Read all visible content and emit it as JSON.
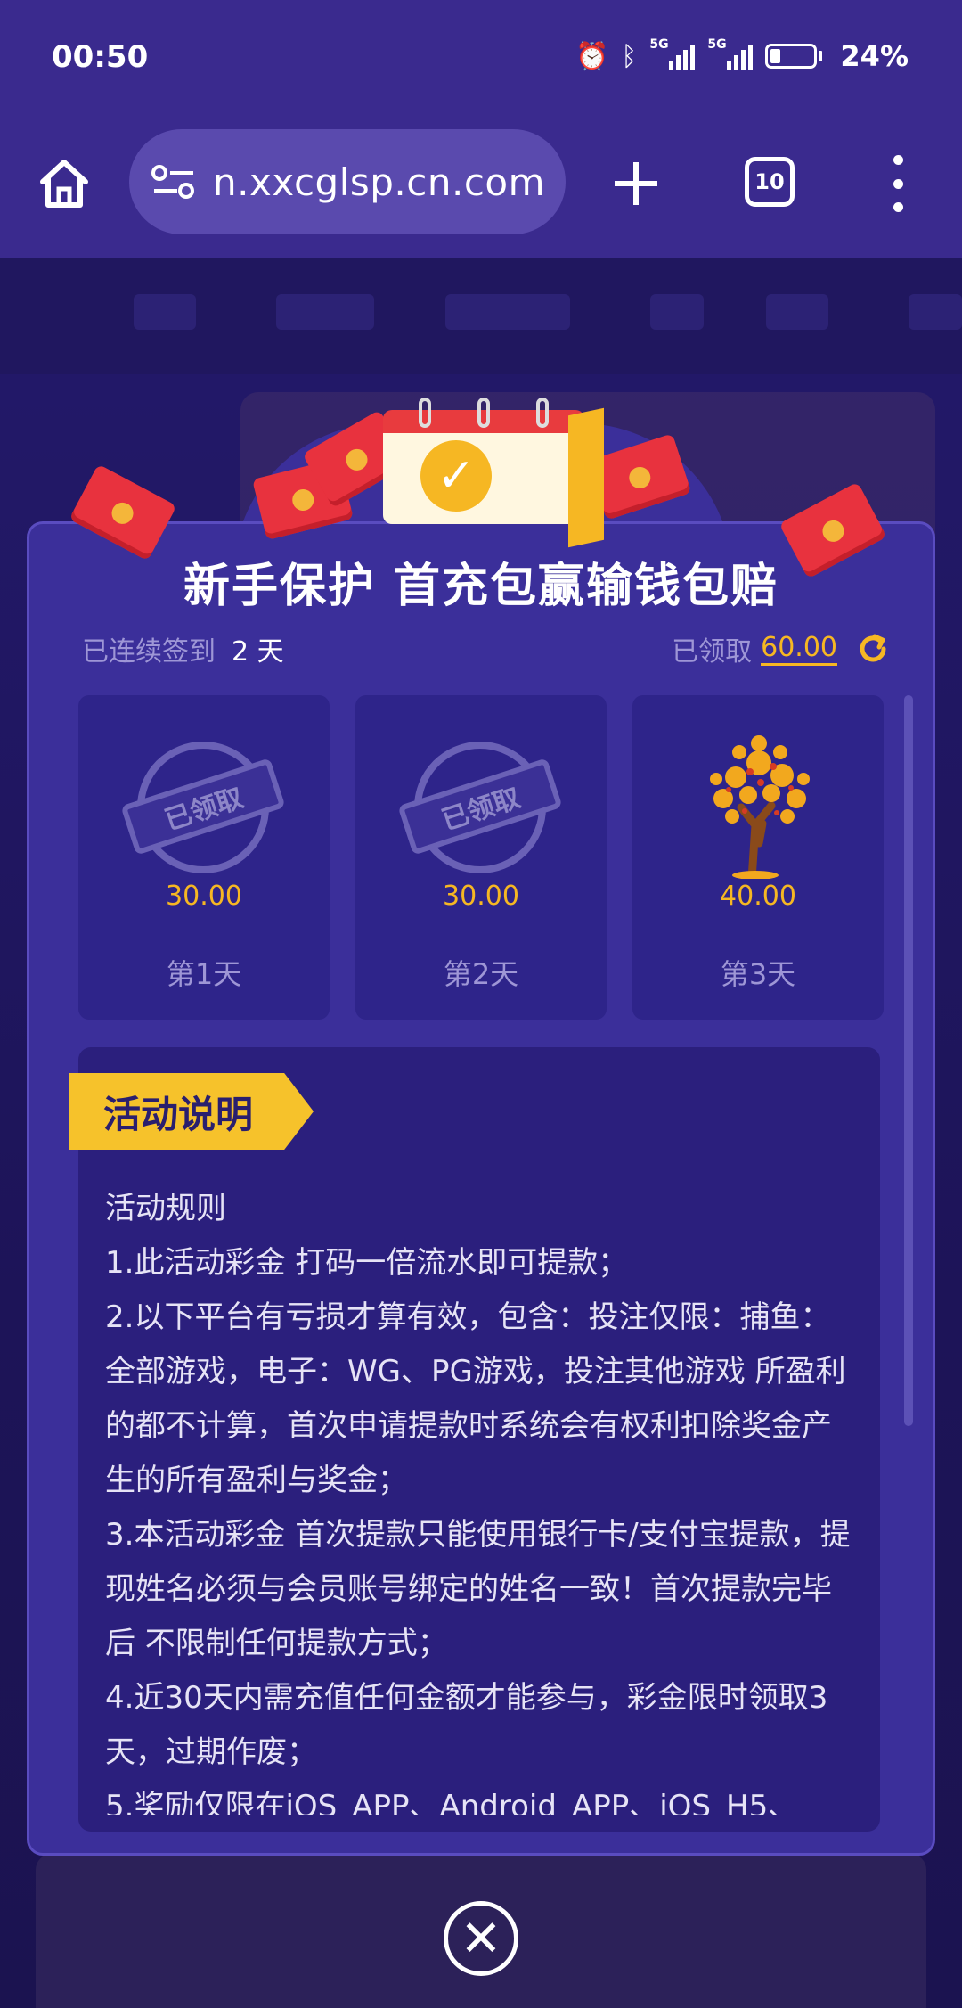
{
  "status_bar": {
    "time": "00:50",
    "net1": "5G",
    "net2": "5G",
    "battery_level": 0.24,
    "battery": "24%"
  },
  "browser": {
    "url": "n.xxcglsp.cn.com",
    "tab_count": "10",
    "icons": {
      "home": "home-icon",
      "site_settings": "tune-icon",
      "new_tab": "plus-icon",
      "tabs": "tabs-icon",
      "menu": "more-vert-icon"
    }
  },
  "modal": {
    "title": "新手保护 首充包赢输钱包赔",
    "streak_label": "已连续签到",
    "streak_value": "2 天",
    "claimed_label": "已领取",
    "claimed_value": "60.00",
    "days": [
      {
        "stamp": "已领取",
        "amount": "30.00",
        "label": "第1天",
        "claimed": true
      },
      {
        "stamp": "已领取",
        "amount": "30.00",
        "label": "第2天",
        "claimed": true
      },
      {
        "stamp": "",
        "amount": "40.00",
        "label": "第3天",
        "claimed": false
      }
    ],
    "desc_tag": "活动说明",
    "rules": [
      "活动规则",
      "1.此活动彩金 打码一倍流水即可提款；",
      "2.以下平台有亏损才算有效，包含：投注仅限：捕鱼：全部游戏，电子：WG、PG游戏，投注其他游戏 所盈利的都不计算，首次申请提款时系统会有权利扣除奖金产生的所有盈利与奖金；",
      "3.本活动彩金 首次提款只能使用银行卡/支付宝提款，提现姓名必须与会员账号绑定的姓名一致！首次提款完毕后 不限制任何提款方式；",
      "4.近30天内需充值任何金额才能参与，彩金限时领取3天，过期作废；",
      "5.奖励仅限在iOS_APP、Android_APP、iOS_H5、"
    ]
  },
  "colors": {
    "accent": "#f6b723",
    "modal_bg": "#3b2f9a",
    "card_bg": "#2e248a",
    "muted_text": "#9e96d6"
  }
}
